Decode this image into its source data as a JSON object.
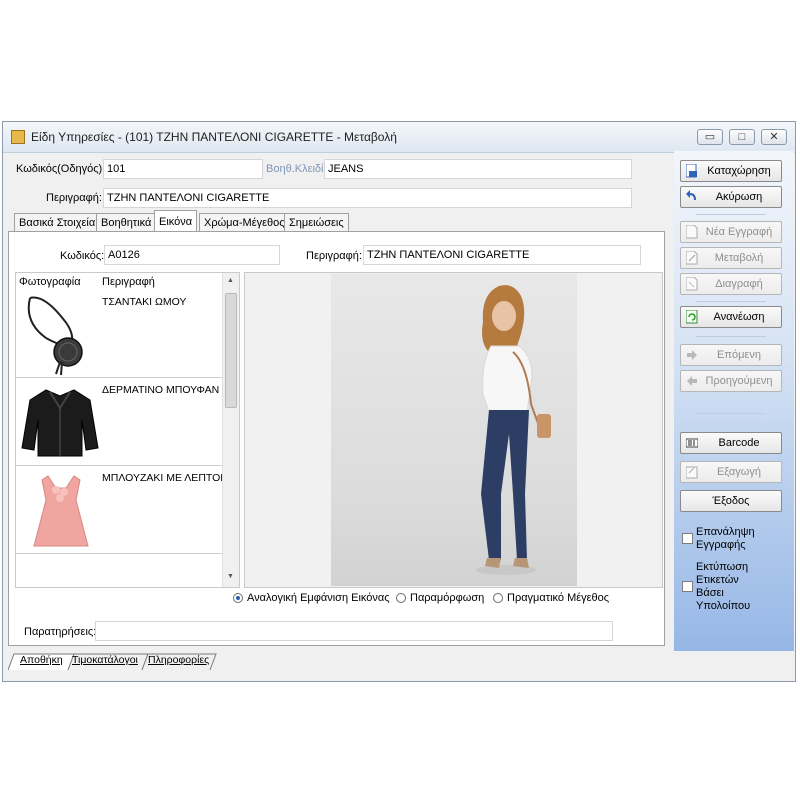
{
  "window": {
    "title": "Είδη Υπηρεσίες - (101) ΤΖΗΝ ΠΑΝΤΕΛΟΝΙ CIGARETTE -  Μεταβολή",
    "controls": {
      "minimize": "▭",
      "maximize": "□",
      "close": "✕"
    }
  },
  "header": {
    "code_label": "Κωδικός(Οδηγός):",
    "code_value": "101",
    "aux_key_label": "Βοηθ.Κλειδί:",
    "aux_key_value": "JEANS",
    "description_label": "Περιγραφή:",
    "description_value": "ΤΖΗΝ ΠΑΝΤΕΛΟΝΙ CIGARETTE"
  },
  "tabs": [
    "Βασικά Στοιχεία",
    "Βοηθητικά",
    "Εικόνα",
    "Χρώμα-Μέγεθος",
    "Σημειώσεις"
  ],
  "active_tab": "Εικόνα",
  "image_tab": {
    "code_label": "Κωδικός:",
    "code_value": "A0126",
    "description_label": "Περιγραφή:",
    "description_value": "ΤΖΗΝ ΠΑΝΤΕΛΟΝΙ CIGARETTE",
    "list_headers": {
      "photo": "Φωτογραφία",
      "description": "Περιγραφή"
    },
    "items": [
      {
        "description": "ΤΣΑΝΤΑΚΙ ΩΜΟΥ",
        "icon": "shoulder-bag"
      },
      {
        "description": "ΔΕΡΜΑΤΙΝΟ ΜΠΟΥΦΑΝ",
        "icon": "leather-jacket"
      },
      {
        "description": "ΜΠΛΟΥΖΑΚΙ ΜΕ ΛΕΠΤΟΜΙ",
        "icon": "pink-blouse"
      }
    ],
    "display_modes": [
      {
        "label": "Αναλογική Εμφάνιση Εικόνας",
        "selected": true
      },
      {
        "label": "Παραμόρφωση",
        "selected": false
      },
      {
        "label": "Πραγματικό Μέγεθος",
        "selected": false
      }
    ],
    "notes_label": "Παρατηρήσεις:",
    "notes_value": ""
  },
  "actions": {
    "save": "Καταχώρηση",
    "cancel": "Ακύρωση",
    "new": "Νέα Εγγραφή",
    "edit": "Μεταβολή",
    "delete": "Διαγραφή",
    "refresh": "Ανανέωση",
    "next": "Επόμενη",
    "previous": "Προηγούμενη",
    "barcode": "Barcode",
    "export": "Εξαγωγή",
    "exit": "Έξοδος",
    "repeat_record": [
      "Επανάληψη",
      "Εγγραφής"
    ],
    "print_labels": [
      "Εκτύπωση",
      "Ετικετών",
      "Βάσει",
      "Υπολοίπου"
    ]
  },
  "bottom_tabs": [
    "Αποθήκη",
    "Τιμοκατάλογοι",
    "Πληροφορίες"
  ],
  "colors": {
    "side_panel_top": "#f3f6fb",
    "side_panel_bottom": "#96b7e6",
    "aux_label": "#7f96b8"
  }
}
